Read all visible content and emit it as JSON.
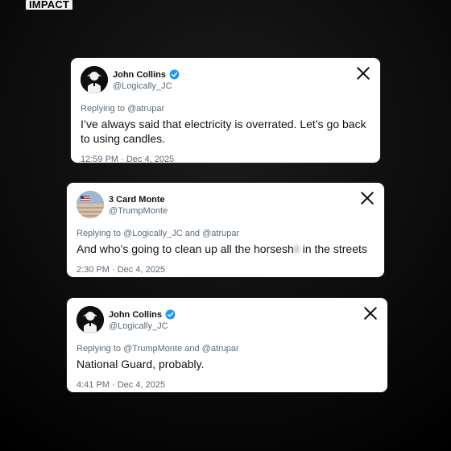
{
  "brand": {
    "label": "IMPACT"
  },
  "tweets": [
    {
      "display_name": "John Collins",
      "handle": "@Logically_JC",
      "replying_prefix": "Replying to",
      "replying_to": "@atrupar",
      "text_parts": {
        "before": "I’ve always said that electricity is overrated. Let’s go back to using candles.",
        "blur": "",
        "after": ""
      },
      "timestamp": "12:59 PM · Dec 4, 2025",
      "verified": true,
      "avatar_icon": "man-with-hat-silhouette-icon"
    },
    {
      "display_name": "3 Card Monte",
      "handle": "@TrumpMonte",
      "replying_prefix": "Replying to",
      "replying_to": "@Logically_JC and @atrupar",
      "text_parts": {
        "before": "And who’s going to clean up all the horsesh",
        "blur": "it",
        "after": " in the streets"
      },
      "timestamp": "2:30 PM · Dec 4, 2025",
      "verified": false,
      "avatar_icon": "flag-profile-icon"
    },
    {
      "display_name": "John Collins",
      "handle": "@Logically_JC",
      "replying_prefix": "Replying to",
      "replying_to": "@TrumpMonte and @atrupar",
      "text_parts": {
        "before": "National Guard, probably.",
        "blur": "",
        "after": ""
      },
      "timestamp": "4:41 PM · Dec 4, 2025",
      "verified": true,
      "avatar_icon": "man-with-hat-silhouette-icon"
    }
  ],
  "colors": {
    "background": "#0b0b0b",
    "card": "#ffffff",
    "text": "#0f1419",
    "secondary_text": "#5d6b78",
    "verified_blue": "#1d9bf0"
  }
}
